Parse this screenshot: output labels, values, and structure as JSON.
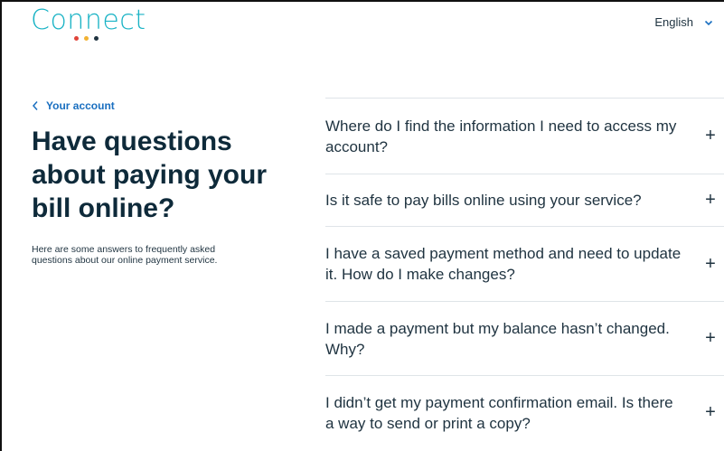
{
  "header": {
    "logo_text": "Connect",
    "logo_dot_colors": [
      "#e0443a",
      "#f2b233",
      "#1f3340"
    ],
    "language_label": "English"
  },
  "nav": {
    "back_label": "Your account"
  },
  "main": {
    "title": "Have questions about paying your bill online?",
    "intro": "Here are some answers to frequently asked questions about our online payment service."
  },
  "faq": [
    {
      "question": "Where do I find the information I need to access my account?"
    },
    {
      "question": "Is it safe to pay bills online using your service?"
    },
    {
      "question": "I have a saved payment method and need to update it. How do I make changes?"
    },
    {
      "question": "I made a payment but my balance hasn’t changed. Why?"
    },
    {
      "question": "I didn’t get my payment confirmation email. Is there a way to send or print a copy?"
    }
  ],
  "icons": {
    "expand_symbol": "+"
  },
  "colors": {
    "brand_teal": "#1ab3c5",
    "link_blue": "#1a6fc0",
    "heading": "#0e2a3a",
    "divider": "#dfe4e8"
  }
}
